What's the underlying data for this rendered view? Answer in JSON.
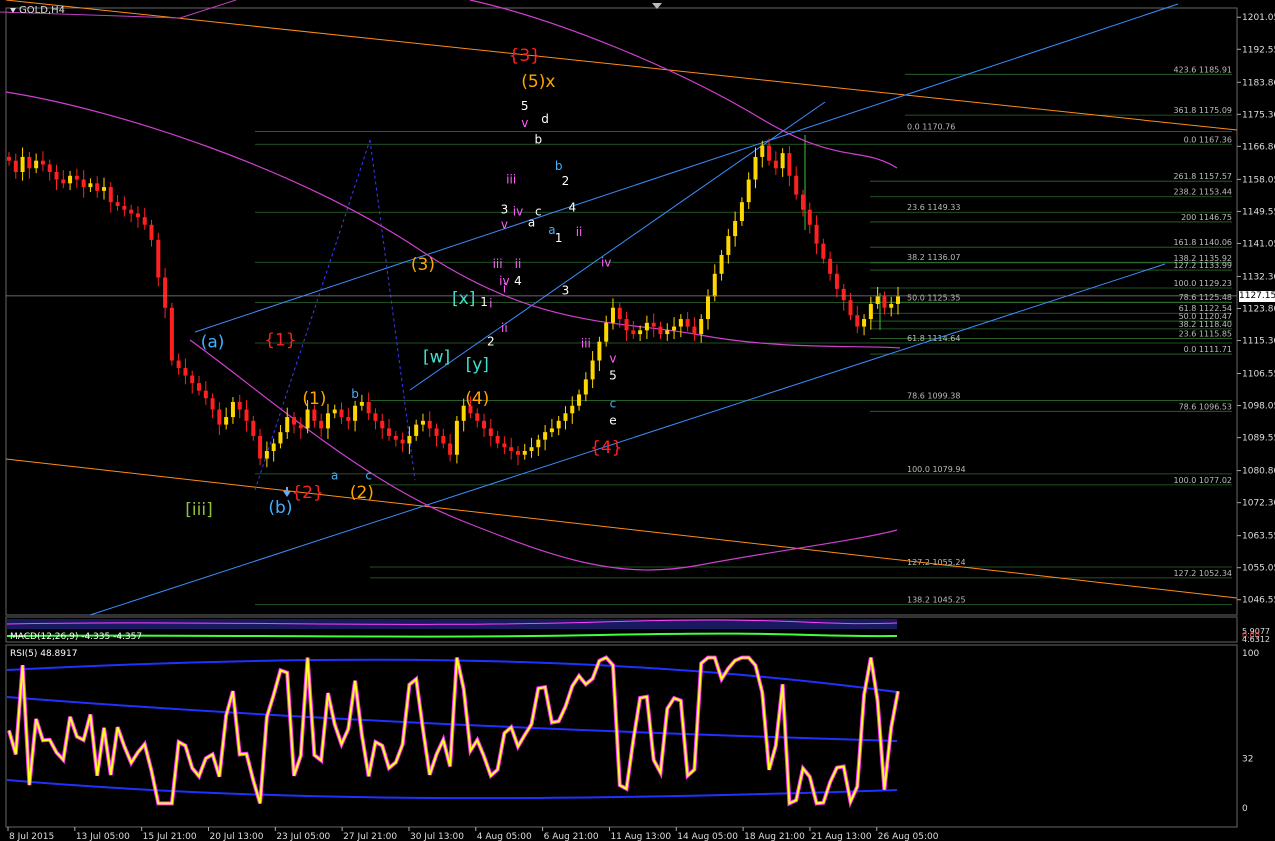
{
  "symbol": "GOLD,H4",
  "current_price": "1127.15",
  "chart_data": {
    "type": "line",
    "title": "GOLD,H4",
    "price_axis": {
      "ticks": [
        "1201.05",
        "1192.55",
        "1183.80",
        "1175.30",
        "1166.80",
        "1158.05",
        "1149.55",
        "1141.05",
        "1132.30",
        "1123.80",
        "1115.30",
        "1106.55",
        "1098.05",
        "1089.55",
        "1080.80",
        "1072.30",
        "1063.55",
        "1055.05",
        "1046.55"
      ],
      "range": [
        1042.5,
        1203.5
      ]
    },
    "time_axis": {
      "ticks": [
        "8 Jul 2015",
        "13 Jul 05:00",
        "15 Jul 21:00",
        "20 Jul 13:00",
        "23 Jul 05:00",
        "27 Jul 21:00",
        "30 Jul 13:00",
        "4 Aug 05:00",
        "6 Aug 21:00",
        "11 Aug 13:00",
        "14 Aug 05:00",
        "18 Aug 21:00",
        "21 Aug 13:00",
        "26 Aug 05:00"
      ]
    },
    "fib_labels": [
      {
        "text": "423.6 1185.91",
        "price": 1185.91
      },
      {
        "text": "361.8 1175.09",
        "price": 1175.09
      },
      {
        "text": "0.0 1170.76",
        "price": 1170.76
      },
      {
        "text": "0.0 1167.36",
        "price": 1167.36
      },
      {
        "text": "261.8 1157.57",
        "price": 1157.57
      },
      {
        "text": "238.2 1153.44",
        "price": 1153.44
      },
      {
        "text": "23.6 1149.33",
        "price": 1149.33
      },
      {
        "text": "200 1146.75",
        "price": 1146.75
      },
      {
        "text": "161.8 1140.06",
        "price": 1140.06
      },
      {
        "text": "38.2 1136.07",
        "price": 1136.07
      },
      {
        "text": "138.2 1135.92",
        "price": 1135.92
      },
      {
        "text": "127.2 1133.99",
        "price": 1133.99
      },
      {
        "text": "100.0 1129.23",
        "price": 1129.23
      },
      {
        "text": "50.0 1125.35",
        "price": 1125.35
      },
      {
        "text": "78.6 1125.48",
        "price": 1125.48
      },
      {
        "text": "61.8 1122.54",
        "price": 1122.54
      },
      {
        "text": "50.0 1120.47",
        "price": 1120.47
      },
      {
        "text": "38.2 1118.40",
        "price": 1118.4
      },
      {
        "text": "23.6 1115.85",
        "price": 1115.85
      },
      {
        "text": "61.8 1114.64",
        "price": 1114.64
      },
      {
        "text": "0.0 1111.71",
        "price": 1111.71
      },
      {
        "text": "78.6 1099.38",
        "price": 1099.38
      },
      {
        "text": "78.6 1096.53",
        "price": 1096.53
      },
      {
        "text": "100.0 1079.94",
        "price": 1079.94
      },
      {
        "text": "100.0 1077.02",
        "price": 1077.02
      },
      {
        "text": "127.2 1055.24",
        "price": 1055.24
      },
      {
        "text": "127.2 1052.34",
        "price": 1052.34
      },
      {
        "text": "138.2 1045.25",
        "price": 1045.25
      }
    ],
    "wave_labels": [
      {
        "text": "{3}",
        "color": "#ff2020",
        "bar": 76,
        "price": 1189.5
      },
      {
        "text": "(5)x",
        "color": "#ffa500",
        "bar": 78,
        "price": 1182.5
      },
      {
        "text": "5",
        "color": "#ffffff",
        "bar": 76,
        "price": 1176.5
      },
      {
        "text": "v",
        "color": "#ff60ff",
        "bar": 76,
        "price": 1172.0
      },
      {
        "text": "d",
        "color": "#ffffff",
        "bar": 79,
        "price": 1173.0
      },
      {
        "text": "b",
        "color": "#ffffff",
        "bar": 78,
        "price": 1167.5
      },
      {
        "text": "b",
        "color": "#40b0ff",
        "bar": 81,
        "price": 1160.5
      },
      {
        "text": "2",
        "color": "#ffffff",
        "bar": 82,
        "price": 1156.5
      },
      {
        "text": "iii",
        "color": "#ff60ff",
        "bar": 74,
        "price": 1157.0
      },
      {
        "text": "3",
        "color": "#ffffff",
        "bar": 73,
        "price": 1149.0
      },
      {
        "text": "iv",
        "color": "#ff60ff",
        "bar": 75,
        "price": 1148.5
      },
      {
        "text": "c",
        "color": "#ffffff",
        "bar": 78,
        "price": 1148.5
      },
      {
        "text": "4",
        "color": "#ffffff",
        "bar": 83,
        "price": 1149.5
      },
      {
        "text": "a",
        "color": "#ffffff",
        "bar": 77,
        "price": 1145.5
      },
      {
        "text": "v",
        "color": "#ff60ff",
        "bar": 73,
        "price": 1145.0
      },
      {
        "text": "a",
        "color": "#40b0ff",
        "bar": 80,
        "price": 1143.5
      },
      {
        "text": "ii",
        "color": "#ff60ff",
        "bar": 84,
        "price": 1143.0
      },
      {
        "text": "1",
        "color": "#ffffff",
        "bar": 81,
        "price": 1141.5
      },
      {
        "text": "iii",
        "color": "#ff60ff",
        "bar": 72,
        "price": 1134.5
      },
      {
        "text": "ii",
        "color": "#ff60ff",
        "bar": 75,
        "price": 1134.5
      },
      {
        "text": "iv",
        "color": "#ff60ff",
        "bar": 88,
        "price": 1135.0
      },
      {
        "text": "(3)",
        "color": "#ffa500",
        "bar": 61,
        "price": 1134.0
      },
      {
        "text": "iv",
        "color": "#ff60ff",
        "bar": 73,
        "price": 1130.0
      },
      {
        "text": "4",
        "color": "#ffffff",
        "bar": 75,
        "price": 1130.0
      },
      {
        "text": "i",
        "color": "#ff60ff",
        "bar": 73,
        "price": 1128.0
      },
      {
        "text": "3",
        "color": "#ffffff",
        "bar": 82,
        "price": 1127.5
      },
      {
        "text": "[x]",
        "color": "#40e0d0",
        "bar": 67,
        "price": 1125.0
      },
      {
        "text": "1",
        "color": "#ffffff",
        "bar": 70,
        "price": 1124.5
      },
      {
        "text": "i",
        "color": "#ff60ff",
        "bar": 71,
        "price": 1124.0
      },
      {
        "text": "ii",
        "color": "#ff60ff",
        "bar": 73,
        "price": 1117.5
      },
      {
        "text": "iii",
        "color": "#ff60ff",
        "bar": 85,
        "price": 1113.5
      },
      {
        "text": "(a)",
        "color": "#40b0ff",
        "bar": 30,
        "price": 1113.5
      },
      {
        "text": "{1}",
        "color": "#ff2020",
        "bar": 40,
        "price": 1114.0
      },
      {
        "text": "2",
        "color": "#ffffff",
        "bar": 71,
        "price": 1114.0
      },
      {
        "text": "[w]",
        "color": "#40e0d0",
        "bar": 63,
        "price": 1109.5
      },
      {
        "text": "v",
        "color": "#ff60ff",
        "bar": 89,
        "price": 1109.5
      },
      {
        "text": "[y]",
        "color": "#40e0d0",
        "bar": 69,
        "price": 1107.5
      },
      {
        "text": "5",
        "color": "#ffffff",
        "bar": 89,
        "price": 1105.0
      },
      {
        "text": "b",
        "color": "#40b0ff",
        "bar": 51,
        "price": 1100.0
      },
      {
        "text": "(1)",
        "color": "#ffa500",
        "bar": 45,
        "price": 1098.5
      },
      {
        "text": "(4)",
        "color": "#ffa500",
        "bar": 69,
        "price": 1098.5
      },
      {
        "text": "c",
        "color": "#40b0ff",
        "bar": 89,
        "price": 1097.5
      },
      {
        "text": "e",
        "color": "#ffffff",
        "bar": 89,
        "price": 1093.0
      },
      {
        "text": "{4}",
        "color": "#ff2020",
        "bar": 88,
        "price": 1085.5
      },
      {
        "text": "a",
        "color": "#40b0ff",
        "bar": 48,
        "price": 1078.5
      },
      {
        "text": "c",
        "color": "#40b0ff",
        "bar": 53,
        "price": 1078.5
      },
      {
        "text": "{2}",
        "color": "#ff2020",
        "bar": 44,
        "price": 1073.5
      },
      {
        "text": "(2)",
        "color": "#ffa500",
        "bar": 52,
        "price": 1073.5
      },
      {
        "text": "(b)",
        "color": "#40b0ff",
        "bar": 40,
        "price": 1069.5
      },
      {
        "text": "[iii]",
        "color": "#90c040",
        "bar": 28,
        "price": 1069.0
      }
    ],
    "closes": [
      1163,
      1160,
      1164,
      1161,
      1163,
      1162,
      1160,
      1158,
      1157,
      1159,
      1158,
      1156,
      1157,
      1155,
      1156,
      1152,
      1151,
      1150,
      1149,
      1148,
      1146,
      1142,
      1132,
      1124,
      1110,
      1108,
      1106,
      1104,
      1102,
      1100,
      1097,
      1093,
      1095,
      1099,
      1097,
      1094,
      1090,
      1084,
      1086,
      1088,
      1091,
      1095,
      1093,
      1092,
      1097,
      1094,
      1092,
      1096,
      1097,
      1095,
      1094,
      1098,
      1099,
      1096,
      1094,
      1092,
      1090,
      1089,
      1088,
      1090,
      1093,
      1094,
      1092,
      1090,
      1088,
      1085,
      1094,
      1098,
      1096,
      1094,
      1092,
      1090,
      1088,
      1087,
      1086,
      1085,
      1086,
      1087,
      1089,
      1091,
      1092,
      1094,
      1096,
      1098,
      1101,
      1105,
      1110,
      1115,
      1120,
      1124,
      1121,
      1118,
      1117,
      1118,
      1120,
      1119,
      1117,
      1118,
      1119,
      1121,
      1119,
      1117,
      1121,
      1127,
      1133,
      1138,
      1143,
      1147,
      1152,
      1158,
      1164,
      1167,
      1163,
      1161,
      1165,
      1159,
      1154,
      1150,
      1146,
      1141,
      1137,
      1133,
      1129,
      1126,
      1122,
      1119,
      1121,
      1125,
      1127,
      1124,
      1125,
      1127
    ],
    "ma_curves": "moving averages (magenta)",
    "indicators": [
      {
        "name": "MACD(12,26,9)",
        "readout": "MACD(12,26,9) -4.335 -4.357"
      },
      {
        "name": "RSI(5)",
        "readout": "RSI(5) 48.8917",
        "ticks": [
          "100",
          "32",
          "0"
        ],
        "range": [
          0,
          100
        ]
      }
    ],
    "macd_right_labels": [
      "5.9077",
      "0.00",
      "4.6312"
    ]
  }
}
